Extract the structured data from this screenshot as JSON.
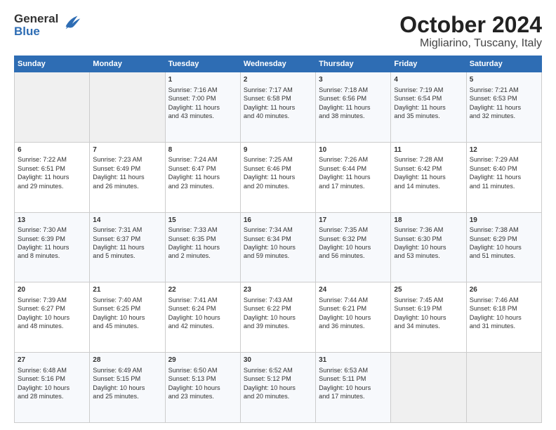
{
  "header": {
    "logo_line1": "General",
    "logo_line2": "Blue",
    "title": "October 2024",
    "subtitle": "Migliarino, Tuscany, Italy"
  },
  "calendar": {
    "days_header": [
      "Sunday",
      "Monday",
      "Tuesday",
      "Wednesday",
      "Thursday",
      "Friday",
      "Saturday"
    ],
    "weeks": [
      [
        {
          "num": "",
          "lines": []
        },
        {
          "num": "",
          "lines": []
        },
        {
          "num": "1",
          "lines": [
            "Sunrise: 7:16 AM",
            "Sunset: 7:00 PM",
            "Daylight: 11 hours",
            "and 43 minutes."
          ]
        },
        {
          "num": "2",
          "lines": [
            "Sunrise: 7:17 AM",
            "Sunset: 6:58 PM",
            "Daylight: 11 hours",
            "and 40 minutes."
          ]
        },
        {
          "num": "3",
          "lines": [
            "Sunrise: 7:18 AM",
            "Sunset: 6:56 PM",
            "Daylight: 11 hours",
            "and 38 minutes."
          ]
        },
        {
          "num": "4",
          "lines": [
            "Sunrise: 7:19 AM",
            "Sunset: 6:54 PM",
            "Daylight: 11 hours",
            "and 35 minutes."
          ]
        },
        {
          "num": "5",
          "lines": [
            "Sunrise: 7:21 AM",
            "Sunset: 6:53 PM",
            "Daylight: 11 hours",
            "and 32 minutes."
          ]
        }
      ],
      [
        {
          "num": "6",
          "lines": [
            "Sunrise: 7:22 AM",
            "Sunset: 6:51 PM",
            "Daylight: 11 hours",
            "and 29 minutes."
          ]
        },
        {
          "num": "7",
          "lines": [
            "Sunrise: 7:23 AM",
            "Sunset: 6:49 PM",
            "Daylight: 11 hours",
            "and 26 minutes."
          ]
        },
        {
          "num": "8",
          "lines": [
            "Sunrise: 7:24 AM",
            "Sunset: 6:47 PM",
            "Daylight: 11 hours",
            "and 23 minutes."
          ]
        },
        {
          "num": "9",
          "lines": [
            "Sunrise: 7:25 AM",
            "Sunset: 6:46 PM",
            "Daylight: 11 hours",
            "and 20 minutes."
          ]
        },
        {
          "num": "10",
          "lines": [
            "Sunrise: 7:26 AM",
            "Sunset: 6:44 PM",
            "Daylight: 11 hours",
            "and 17 minutes."
          ]
        },
        {
          "num": "11",
          "lines": [
            "Sunrise: 7:28 AM",
            "Sunset: 6:42 PM",
            "Daylight: 11 hours",
            "and 14 minutes."
          ]
        },
        {
          "num": "12",
          "lines": [
            "Sunrise: 7:29 AM",
            "Sunset: 6:40 PM",
            "Daylight: 11 hours",
            "and 11 minutes."
          ]
        }
      ],
      [
        {
          "num": "13",
          "lines": [
            "Sunrise: 7:30 AM",
            "Sunset: 6:39 PM",
            "Daylight: 11 hours",
            "and 8 minutes."
          ]
        },
        {
          "num": "14",
          "lines": [
            "Sunrise: 7:31 AM",
            "Sunset: 6:37 PM",
            "Daylight: 11 hours",
            "and 5 minutes."
          ]
        },
        {
          "num": "15",
          "lines": [
            "Sunrise: 7:33 AM",
            "Sunset: 6:35 PM",
            "Daylight: 11 hours",
            "and 2 minutes."
          ]
        },
        {
          "num": "16",
          "lines": [
            "Sunrise: 7:34 AM",
            "Sunset: 6:34 PM",
            "Daylight: 10 hours",
            "and 59 minutes."
          ]
        },
        {
          "num": "17",
          "lines": [
            "Sunrise: 7:35 AM",
            "Sunset: 6:32 PM",
            "Daylight: 10 hours",
            "and 56 minutes."
          ]
        },
        {
          "num": "18",
          "lines": [
            "Sunrise: 7:36 AM",
            "Sunset: 6:30 PM",
            "Daylight: 10 hours",
            "and 53 minutes."
          ]
        },
        {
          "num": "19",
          "lines": [
            "Sunrise: 7:38 AM",
            "Sunset: 6:29 PM",
            "Daylight: 10 hours",
            "and 51 minutes."
          ]
        }
      ],
      [
        {
          "num": "20",
          "lines": [
            "Sunrise: 7:39 AM",
            "Sunset: 6:27 PM",
            "Daylight: 10 hours",
            "and 48 minutes."
          ]
        },
        {
          "num": "21",
          "lines": [
            "Sunrise: 7:40 AM",
            "Sunset: 6:25 PM",
            "Daylight: 10 hours",
            "and 45 minutes."
          ]
        },
        {
          "num": "22",
          "lines": [
            "Sunrise: 7:41 AM",
            "Sunset: 6:24 PM",
            "Daylight: 10 hours",
            "and 42 minutes."
          ]
        },
        {
          "num": "23",
          "lines": [
            "Sunrise: 7:43 AM",
            "Sunset: 6:22 PM",
            "Daylight: 10 hours",
            "and 39 minutes."
          ]
        },
        {
          "num": "24",
          "lines": [
            "Sunrise: 7:44 AM",
            "Sunset: 6:21 PM",
            "Daylight: 10 hours",
            "and 36 minutes."
          ]
        },
        {
          "num": "25",
          "lines": [
            "Sunrise: 7:45 AM",
            "Sunset: 6:19 PM",
            "Daylight: 10 hours",
            "and 34 minutes."
          ]
        },
        {
          "num": "26",
          "lines": [
            "Sunrise: 7:46 AM",
            "Sunset: 6:18 PM",
            "Daylight: 10 hours",
            "and 31 minutes."
          ]
        }
      ],
      [
        {
          "num": "27",
          "lines": [
            "Sunrise: 6:48 AM",
            "Sunset: 5:16 PM",
            "Daylight: 10 hours",
            "and 28 minutes."
          ]
        },
        {
          "num": "28",
          "lines": [
            "Sunrise: 6:49 AM",
            "Sunset: 5:15 PM",
            "Daylight: 10 hours",
            "and 25 minutes."
          ]
        },
        {
          "num": "29",
          "lines": [
            "Sunrise: 6:50 AM",
            "Sunset: 5:13 PM",
            "Daylight: 10 hours",
            "and 23 minutes."
          ]
        },
        {
          "num": "30",
          "lines": [
            "Sunrise: 6:52 AM",
            "Sunset: 5:12 PM",
            "Daylight: 10 hours",
            "and 20 minutes."
          ]
        },
        {
          "num": "31",
          "lines": [
            "Sunrise: 6:53 AM",
            "Sunset: 5:11 PM",
            "Daylight: 10 hours",
            "and 17 minutes."
          ]
        },
        {
          "num": "",
          "lines": []
        },
        {
          "num": "",
          "lines": []
        }
      ]
    ]
  }
}
